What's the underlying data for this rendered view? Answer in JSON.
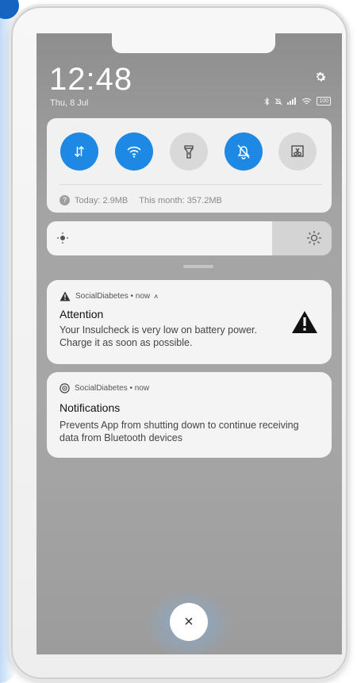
{
  "status_bar": {
    "time": "12:48",
    "date": "Thu, 8 Jul",
    "battery": "100"
  },
  "icons": {
    "settings": "gear-icon",
    "bluetooth": "bluetooth-icon",
    "mute": "bell-off-icon",
    "signal": "signal-icon",
    "wifi": "wifi-icon",
    "battery": "battery-icon"
  },
  "quick_settings": {
    "toggles": [
      {
        "name": "mobile-data",
        "state": "on"
      },
      {
        "name": "wifi",
        "state": "on"
      },
      {
        "name": "flashlight",
        "state": "off"
      },
      {
        "name": "silent",
        "state": "on"
      },
      {
        "name": "screenshot",
        "state": "off"
      }
    ],
    "data_usage": {
      "today": "Today: 2.9MB",
      "month": "This month: 357.2MB"
    }
  },
  "brightness": {
    "level": 0.79
  },
  "notifications": [
    {
      "app": "SocialDiabetes",
      "meta": "SocialDiabetes • now",
      "expand_caret": "˄",
      "title": "Attention",
      "body": "Your Insulcheck is very low on battery power. Charge it as soon as possible."
    },
    {
      "app": "SocialDiabetes",
      "meta": "SocialDiabetes • now",
      "title": "Notifications",
      "body": "Prevents App from shutting down to continue receiving data from Bluetooth devices"
    }
  ],
  "close_button": {
    "label": "×"
  },
  "colors": {
    "accent": "#1e88e5",
    "card": "#f4f4f4",
    "shade": "#a4a4a4"
  }
}
